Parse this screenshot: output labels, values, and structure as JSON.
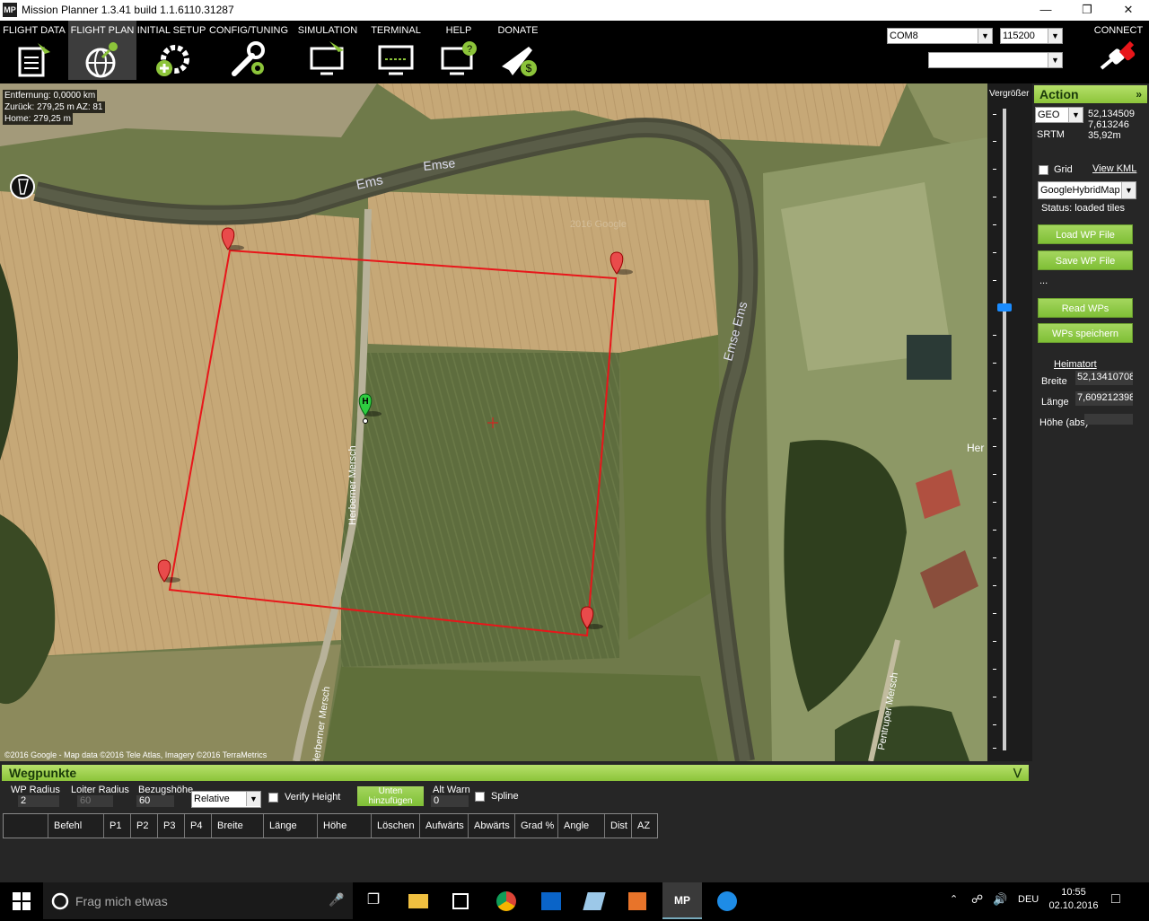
{
  "window": {
    "title": "Mission Planner 1.3.41 build 1.1.6110.31287",
    "logo_text": "MP"
  },
  "menu": [
    {
      "label": "FLIGHT DATA"
    },
    {
      "label": "FLIGHT PLAN"
    },
    {
      "label": "INITIAL SETUP"
    },
    {
      "label": "CONFIG/TUNING"
    },
    {
      "label": "SIMULATION"
    },
    {
      "label": "TERMINAL"
    },
    {
      "label": "HELP"
    },
    {
      "label": "DONATE"
    }
  ],
  "connection": {
    "port": "COM8",
    "baud": "115200",
    "extra": "",
    "connect_label": "CONNECT"
  },
  "map": {
    "info_distance": "Entfernung: 0,0000 km",
    "info_back": "Zurück: 279,25 m AZ: 81",
    "info_home": "Home: 279,25 m",
    "copyright": "©2016 Google - Map data ©2016 Tele Atlas, Imagery ©2016 TerraMetrics",
    "label_ems1": "Ems",
    "label_ems2": "Emse",
    "label_emse_ems": "Emse Ems",
    "label_road1": "Herberner Mersch",
    "label_road2": "Herberner Mersch",
    "label_road3": "Pentruper Mersch",
    "label_her": "Her",
    "watermark": "2016 Google",
    "home_marker": "H"
  },
  "zoom": {
    "label": "Vergrößer",
    "level": 0.3
  },
  "action_panel": {
    "header": "Action",
    "coord_system": "GEO",
    "lat": "52,134509",
    "lng": "7,613246",
    "alt": "35,92m",
    "srtm": "SRTM",
    "grid_label": "Grid",
    "view_kml": "View KML",
    "map_type": "GoogleHybridMap",
    "status": "Status: loaded tiles",
    "load_wp": "Load WP File",
    "save_wp": "Save WP File",
    "ellipsis": "...",
    "read_wps": "Read WPs",
    "write_wps": "WPs speichern",
    "home_header": "Heimatort",
    "home_lat_label": "Breite",
    "home_lat": "52,13410708",
    "home_lng_label": "Länge",
    "home_lng": "7,609212398",
    "home_alt_label": "Höhe (abs)",
    "home_alt": ""
  },
  "waypoints": {
    "header": "Wegpunkte",
    "wp_radius_label": "WP Radius",
    "wp_radius": "2",
    "loiter_label": "Loiter Radius",
    "loiter": "60",
    "ref_alt_label": "Bezugshöhe",
    "ref_alt": "60",
    "alt_mode": "Relative",
    "verify_height": "Verify Height",
    "add_below_1": "Unten",
    "add_below_2": "hinzufügen",
    "alt_warn_label": "Alt Warn",
    "alt_warn": "0",
    "spline": "Spline",
    "columns": [
      "",
      "Befehl",
      "P1",
      "P2",
      "P3",
      "P4",
      "Breite",
      "Länge",
      "Höhe",
      "Löschen",
      "Aufwärts",
      "Abwärts",
      "Grad %",
      "Angle",
      "Dist",
      "AZ"
    ]
  },
  "taskbar": {
    "search_placeholder": "Frag mich etwas",
    "language": "DEU",
    "time": "10:55",
    "date": "02.10.2016"
  },
  "colors": {
    "accent_green": "#8cc43a",
    "route_red": "#e8161a",
    "home_green": "#2ecc40"
  }
}
